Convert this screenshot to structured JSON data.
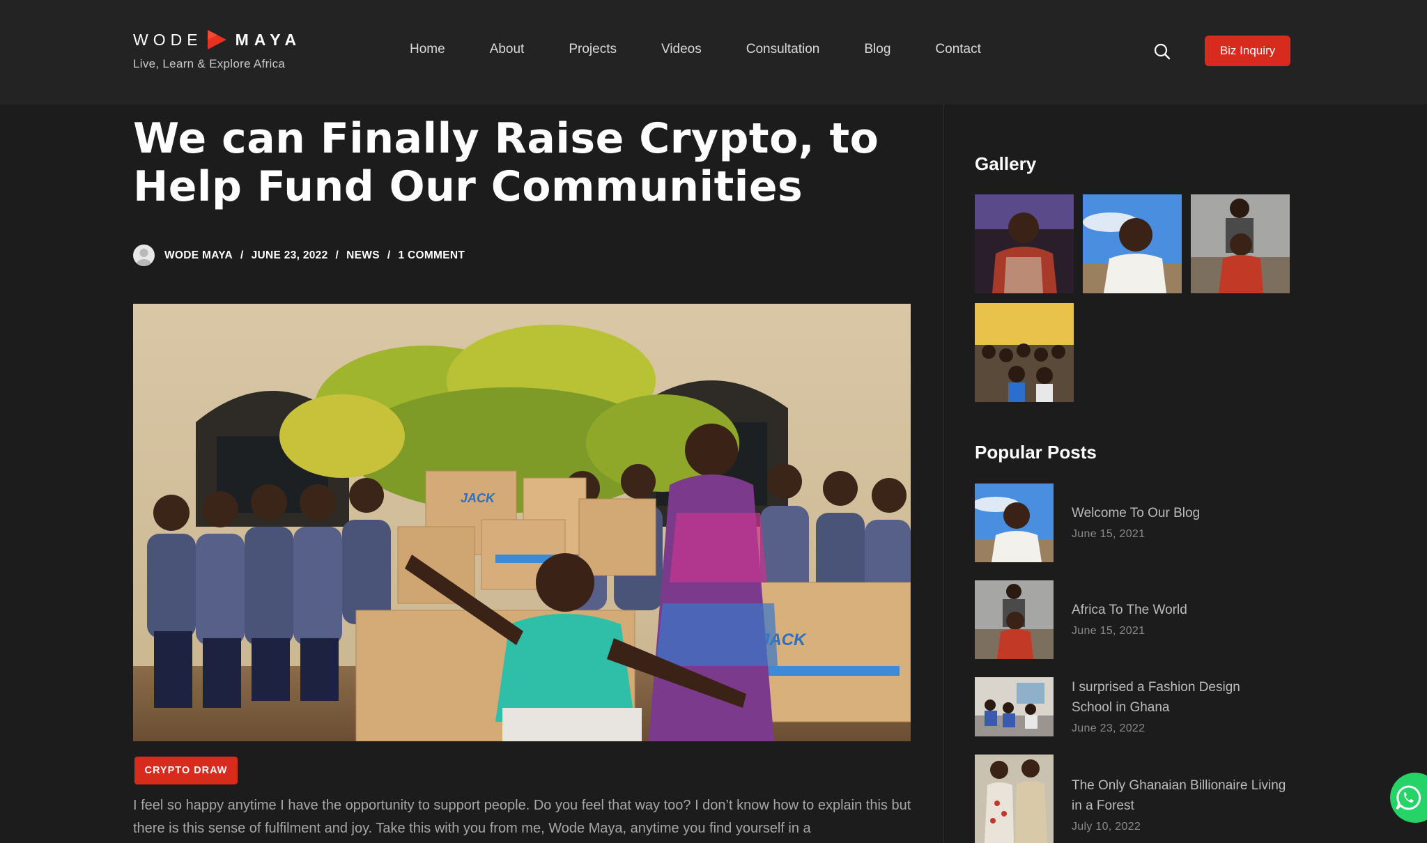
{
  "header": {
    "logo": {
      "word1": "WODE",
      "word2": "MAYA",
      "tagline": "Live, Learn & Explore Africa"
    },
    "nav": [
      "Home",
      "About",
      "Projects",
      "Videos",
      "Consultation",
      "Blog",
      "Contact"
    ],
    "search_icon": "search-icon",
    "cta_label": "Biz Inquiry"
  },
  "post": {
    "title": "We can Finally Raise Crypto, to Help Fund Our Communities",
    "meta": {
      "author": "WODE MAYA",
      "date": "JUNE 23, 2022",
      "category": "NEWS",
      "comments": "1 COMMENT"
    },
    "tag": "CRYPTO DRAW",
    "excerpt": "I feel so happy anytime I have the opportunity to support people. Do you feel that way too? I don’t know how to explain this but there is this sense of fulfilment and joy. Take this with you from me, Wode Maya, anytime you find yourself in a"
  },
  "sidebar": {
    "gallery_title": "Gallery",
    "popular_title": "Popular Posts",
    "popular_posts": [
      {
        "title": "Welcome To Our Blog",
        "date": "June 15, 2021"
      },
      {
        "title": "Africa To The World",
        "date": "June 15, 2021"
      },
      {
        "title": "I surprised a Fashion Design School in Ghana",
        "date": "June 23, 2022"
      },
      {
        "title": "The Only Ghanaian Billionaire Living in a Forest",
        "date": "July 10, 2022"
      }
    ]
  },
  "colors": {
    "accent": "#d62b1d",
    "background": "#1c1c1c",
    "header": "#232323",
    "whatsapp": "#25d366"
  },
  "icons": {
    "whatsapp": "whatsapp-icon"
  }
}
